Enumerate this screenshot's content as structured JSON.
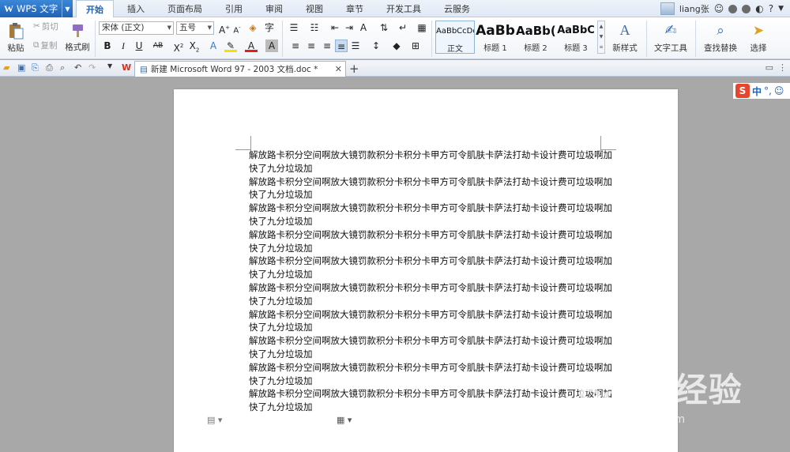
{
  "app": {
    "name": "WPS 文字"
  },
  "tabs": [
    "开始",
    "插入",
    "页面布局",
    "引用",
    "审阅",
    "视图",
    "章节",
    "开发工具",
    "云服务"
  ],
  "active_tab": 0,
  "user": {
    "name": "liang张"
  },
  "ribbon": {
    "paste": "粘贴",
    "cut": "剪切",
    "copy": "复制",
    "format_painter": "格式刷",
    "font_name": "宋体 (正文)",
    "font_size": "五号",
    "styles": [
      {
        "sample": "AaBbCcDd",
        "name": "正文"
      },
      {
        "sample": "AaBb",
        "name": "标题 1"
      },
      {
        "sample": "AaBb(",
        "name": "标题 2"
      },
      {
        "sample": "AaBbC",
        "name": "标题 3"
      }
    ],
    "new_style": "新样式",
    "text_tools": "文字工具",
    "find_replace": "查找替换",
    "select": "选择"
  },
  "document_tab": {
    "title": "新建 Microsoft Word 97 - 2003 文档.doc *"
  },
  "document": {
    "paragraphs": [
      "解放路卡积分空间啊放大镜罚款积分卡积分卡甲方可令肌肤卡萨法打劫卡设计费可垃圾啊加快了九分垃圾加",
      "解放路卡积分空间啊放大镜罚款积分卡积分卡甲方可令肌肤卡萨法打劫卡设计费可垃圾啊加快了九分垃圾加",
      "解放路卡积分空间啊放大镜罚款积分卡积分卡甲方可令肌肤卡萨法打劫卡设计费可垃圾啊加快了九分垃圾加",
      "解放路卡积分空间啊放大镜罚款积分卡积分卡甲方可令肌肤卡萨法打劫卡设计费可垃圾啊加快了九分垃圾加",
      "解放路卡积分空间啊放大镜罚款积分卡积分卡甲方可令肌肤卡萨法打劫卡设计费可垃圾啊加快了九分垃圾加",
      "解放路卡积分空间啊放大镜罚款积分卡积分卡甲方可令肌肤卡萨法打劫卡设计费可垃圾啊加快了九分垃圾加",
      "解放路卡积分空间啊放大镜罚款积分卡积分卡甲方可令肌肤卡萨法打劫卡设计费可垃圾啊加快了九分垃圾加",
      "解放路卡积分空间啊放大镜罚款积分卡积分卡甲方可令肌肤卡萨法打劫卡设计费可垃圾啊加快了九分垃圾加",
      "解放路卡积分空间啊放大镜罚款积分卡积分卡甲方可令肌肤卡萨法打劫卡设计费可垃圾啊加快了九分垃圾加",
      "解放路卡积分空间啊放大镜罚款积分卡积分卡甲方可令肌肤卡萨法打劫卡设计费可垃圾啊加快了九分垃圾加"
    ]
  },
  "ime": {
    "logo": "S",
    "mode": "中"
  },
  "watermark": {
    "brand": "Baidu经验",
    "url": "jingyan.baidu.com"
  },
  "colors": {
    "accent": "#1f63b6",
    "workspace": "#a8a8a8",
    "sogou": "#e8462c"
  }
}
